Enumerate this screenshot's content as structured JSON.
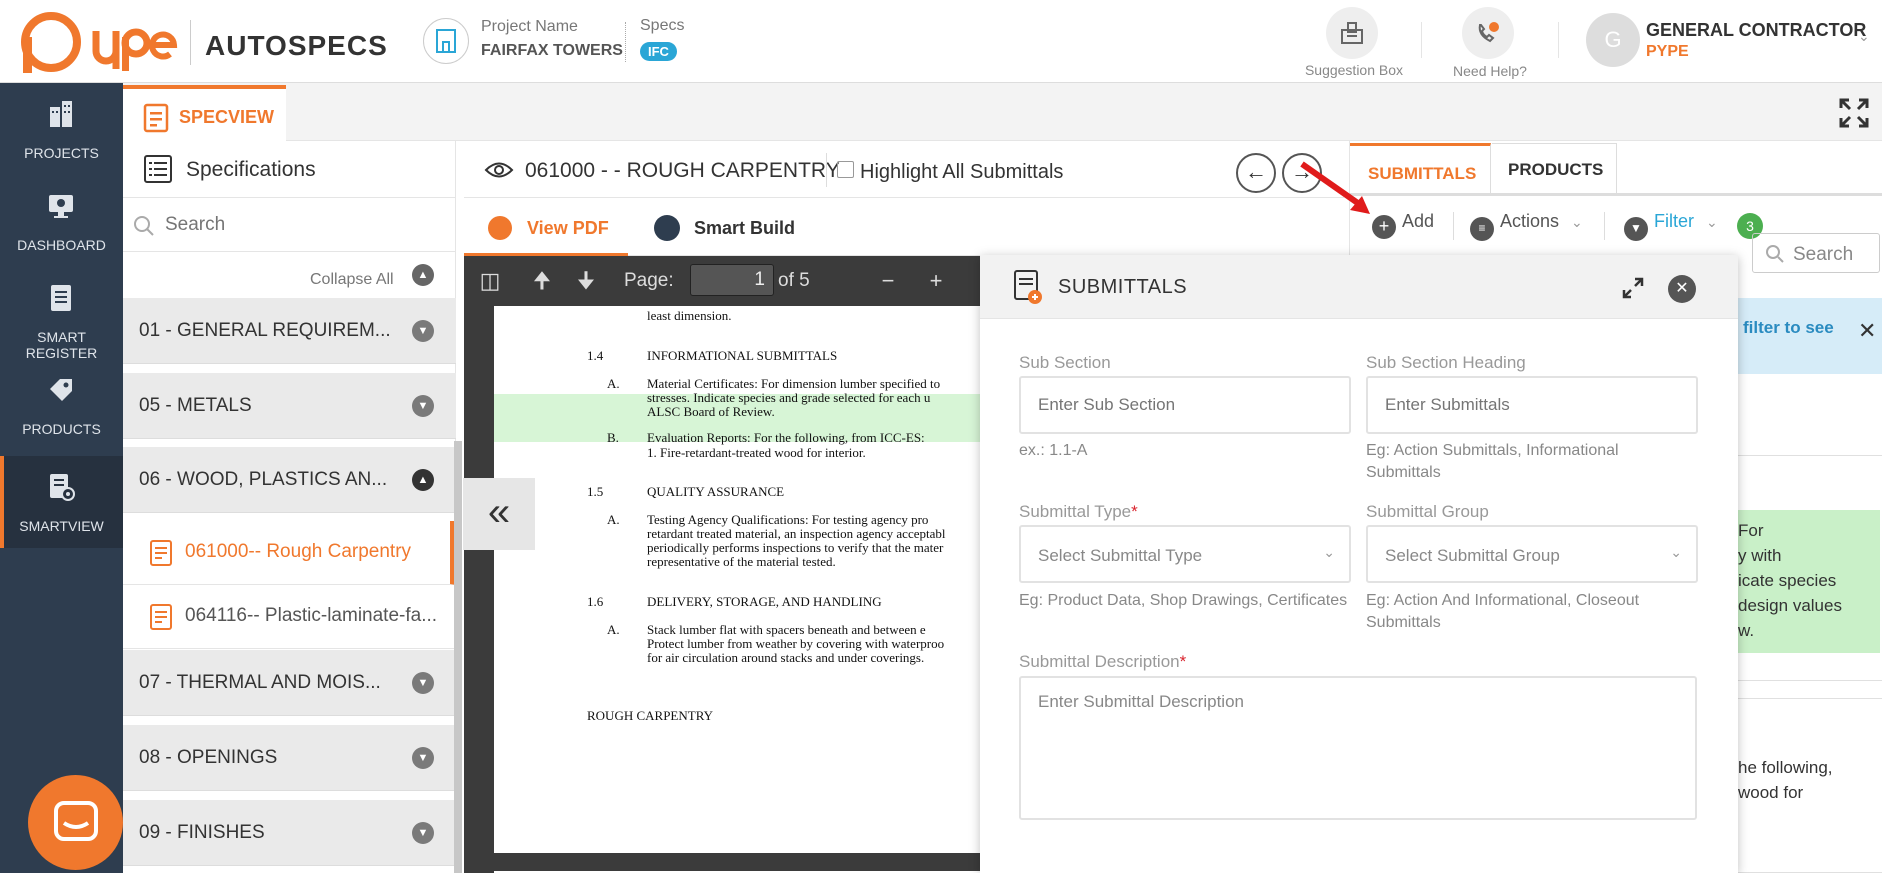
{
  "header": {
    "brand": "Pype",
    "product": "AUTOSPECS",
    "project_label": "Project Name",
    "project_name": "FAIRFAX TOWERS",
    "specs_label": "Specs",
    "specs_badge": "IFC",
    "suggestion_label": "Suggestion Box",
    "help_label": "Need Help?",
    "avatar_initial": "G",
    "user_name": "GENERAL CONTRACTOR",
    "user_company": "PYPE"
  },
  "leftnav": {
    "items": [
      {
        "label": "PROJECTS",
        "icon": "building-icon"
      },
      {
        "label": "DASHBOARD",
        "icon": "monitor-icon"
      },
      {
        "label": "SMART REGISTER",
        "icon": "register-icon"
      },
      {
        "label": "PRODUCTS",
        "icon": "tag-icon"
      },
      {
        "label": "SMARTVIEW",
        "icon": "smartview-icon",
        "active": true
      }
    ]
  },
  "tabbar": {
    "specview_label": "SPECVIEW"
  },
  "specifications": {
    "title": "Specifications",
    "search_placeholder": "Search",
    "collapse_all": "Collapse All",
    "sections": [
      {
        "label": "01 - GENERAL REQUIREM..."
      },
      {
        "label": "05 - METALS"
      },
      {
        "label": "06 - WOOD, PLASTICS AN...",
        "expanded": true
      },
      {
        "label": "07 - THERMAL AND MOIS..."
      },
      {
        "label": "08 - OPENINGS"
      },
      {
        "label": "09 - FINISHES"
      }
    ],
    "files": [
      {
        "label": "061000-- Rough Carpentry",
        "active": true
      },
      {
        "label": "064116-- Plastic-laminate-fa..."
      }
    ]
  },
  "document": {
    "title": "061000 - - ROUGH CARPENTRY",
    "highlight_label": "Highlight All Submittals",
    "view_pdf_label": "View PDF",
    "smart_build_label": "Smart Build",
    "page_label": "Page:",
    "page_value": "1",
    "page_total": "of 5",
    "pdf_lines": [
      {
        "text": "least dimension."
      },
      {
        "text": "1.4"
      },
      {
        "text": "INFORMATIONAL SUBMITTALS"
      },
      {
        "text": "A."
      },
      {
        "text": "Material Certificates:  For dimension lumber specified to"
      },
      {
        "text": "stresses.  Indicate species and grade selected for each u"
      },
      {
        "text": "ALSC Board of Review."
      },
      {
        "text": "B."
      },
      {
        "text": "Evaluation Reports:  For the following, from ICC-ES:"
      },
      {
        "text": "1.      Fire-retardant-treated wood for interior."
      },
      {
        "text": "1.5"
      },
      {
        "text": "QUALITY ASSURANCE"
      },
      {
        "text": "A."
      },
      {
        "text": "Testing Agency Qualifications:  For testing agency pro"
      },
      {
        "text": "retardant treated material, an inspection agency acceptabl"
      },
      {
        "text": "periodically performs inspections to verify that the mater"
      },
      {
        "text": "representative of the material tested."
      },
      {
        "text": "1.6"
      },
      {
        "text": "DELIVERY, STORAGE, AND HANDLING"
      },
      {
        "text": "A."
      },
      {
        "text": "Stack lumber flat with spacers beneath and between e"
      },
      {
        "text": "Protect lumber from weather by covering with waterproo"
      },
      {
        "text": "for air circulation around stacks and under coverings."
      },
      {
        "text": "ROUGH CARPENTRY"
      }
    ]
  },
  "submittals_panel": {
    "tabs": [
      "SUBMITTALS",
      "PRODUCTS"
    ],
    "add_label": "Add",
    "actions_label": "Actions",
    "filter_label": "Filter",
    "filter_count": "3",
    "search_placeholder": "Search",
    "info_text": "filter to see",
    "card1_lines": [
      "For",
      "y with",
      "icate species",
      "design values",
      "w."
    ],
    "card2_lines": [
      "he following,",
      "wood for"
    ]
  },
  "modal": {
    "title": "SUBMITTALS",
    "sub_section_label": "Sub Section",
    "sub_section_placeholder": "Enter Sub Section",
    "sub_section_hint": "ex.: 1.1-A",
    "heading_label": "Sub Section Heading",
    "heading_placeholder": "Enter Submittals",
    "heading_hint": "Eg: Action Submittals, Informational Submittals",
    "type_label": "Submittal Type",
    "type_placeholder": "Select Submittal Type",
    "type_hint": "Eg: Product Data, Shop Drawings, Certificates",
    "group_label": "Submittal Group",
    "group_placeholder": "Select Submittal Group",
    "group_hint": "Eg: Action And Informational, Closeout Submittals",
    "description_label": "Submittal Description",
    "description_placeholder": "Enter Submittal Description",
    "required_mark": "*"
  },
  "colors": {
    "brand_orange": "#f0782d",
    "nav_dark": "#2e3d4f",
    "accent_blue": "#2aa6d6",
    "success_green": "#4caf50"
  }
}
